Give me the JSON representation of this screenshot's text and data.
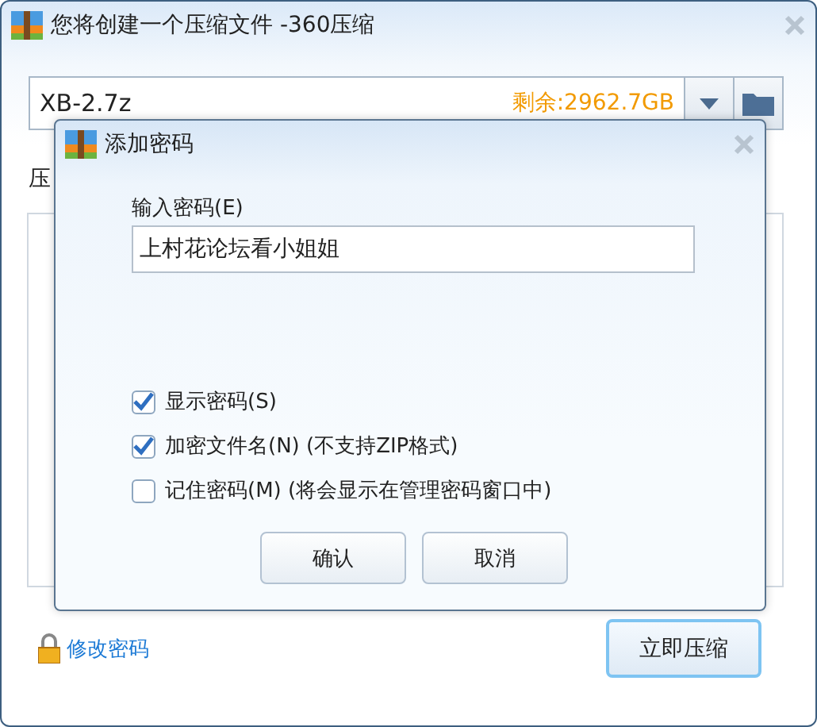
{
  "window": {
    "title": "您将创建一个压缩文件 -360压缩"
  },
  "path_field": {
    "value": "XB-2.7z",
    "free_space": "剩余:2962.7GB"
  },
  "section_label": "压",
  "dialog": {
    "title": "添加密码",
    "password_label": "输入密码(E)",
    "password": "上村花论坛看小姐姐",
    "options": [
      {
        "label": "显示密码(S)",
        "checked": true
      },
      {
        "label": "加密文件名(N) (不支持ZIP格式)",
        "checked": true
      },
      {
        "label": "记住密码(M) (将会显示在管理密码窗口中)",
        "checked": false
      }
    ],
    "buttons": [
      "确认",
      "取消"
    ]
  },
  "change_password_link": "修改密码",
  "compress_button": "立即压缩"
}
